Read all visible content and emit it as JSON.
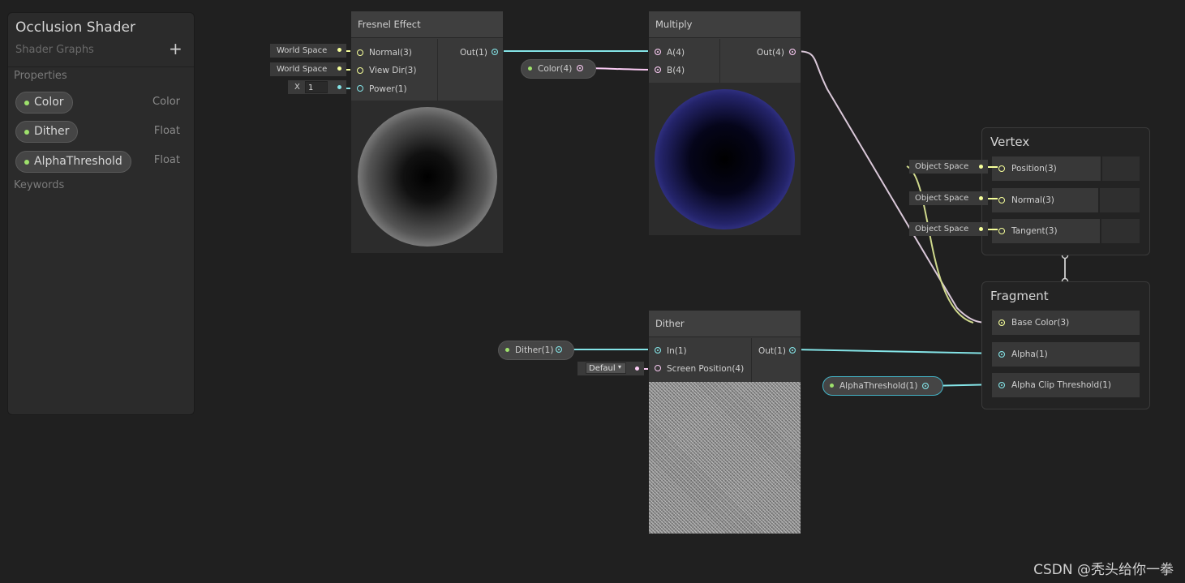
{
  "blackboard": {
    "title": "Occlusion Shader",
    "subtitle": "Shader Graphs",
    "add_label": "+",
    "properties_label": "Properties",
    "keywords_label": "Keywords",
    "properties": [
      {
        "name": "Color",
        "type": "Color"
      },
      {
        "name": "Dither",
        "type": "Float"
      },
      {
        "name": "AlphaThreshold",
        "type": "Float"
      }
    ]
  },
  "fresnel": {
    "title": "Fresnel Effect",
    "inputs": [
      "Normal(3)",
      "View Dir(3)",
      "Power(1)"
    ],
    "output": "Out(1)",
    "normal_space": "World Space",
    "viewdir_space": "World Space",
    "power_axis": "X",
    "power_value": "1"
  },
  "multiply": {
    "title": "Multiply",
    "inputs": [
      "A(4)",
      "B(4)"
    ],
    "output": "Out(4)"
  },
  "color_prop": {
    "label": "Color(4)"
  },
  "dither": {
    "title": "Dither",
    "inputs": [
      "In(1)",
      "Screen Position(4)"
    ],
    "output": "Out(1)",
    "screen_mode": "Defaul"
  },
  "dither_prop": {
    "label": "Dither(1)"
  },
  "alpha_prop": {
    "label": "AlphaThreshold(1)"
  },
  "vertex": {
    "title": "Vertex",
    "slots": [
      "Position(3)",
      "Normal(3)",
      "Tangent(3)"
    ],
    "space_label": "Object Space"
  },
  "fragment": {
    "title": "Fragment",
    "slots": [
      "Base Color(3)",
      "Alpha(1)",
      "Alpha Clip Threshold(1)"
    ]
  },
  "watermark": "CSDN @秃头给你一拳",
  "colors": {
    "vec1": "#84e4e7",
    "vec3": "#f6ff9a",
    "vec4": "#fbcbf4",
    "prop_dot": "#9ee16c",
    "fresnel_preview": "#000000",
    "multiply_rim": "#6b6cf0"
  }
}
